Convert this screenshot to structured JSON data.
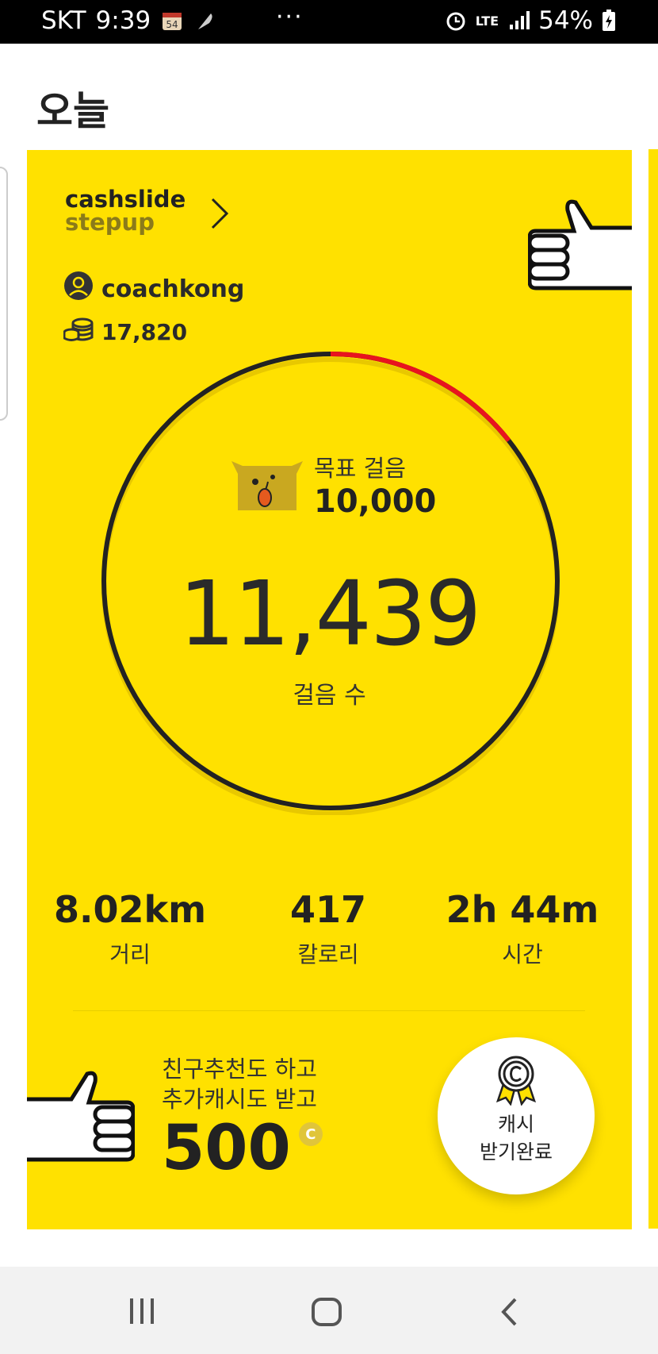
{
  "status_bar": {
    "carrier": "SKT",
    "time": "9:39",
    "calendar_badge": "54",
    "more": "···",
    "network": "LTE",
    "battery": "54%"
  },
  "page": {
    "title": "오늘"
  },
  "card": {
    "brand_line1": "cashslide",
    "brand_line2": "stepup",
    "username": "coachkong",
    "cash_balance": "17,820",
    "goal_label": "목표 걸음",
    "goal_value": "10,000",
    "steps_value": "11,439",
    "steps_label": "걸음 수",
    "progress_fraction": 0.1439,
    "stats": [
      {
        "value": "8.02km",
        "label": "거리"
      },
      {
        "value": "417",
        "label": "칼로리"
      },
      {
        "value": "2h 44m",
        "label": "시간"
      }
    ],
    "promo_line1": "친구추천도 하고",
    "promo_line2": "추가캐시도 받고",
    "promo_amount": "500",
    "coin_symbol": "C",
    "cash_button_line1": "캐시",
    "cash_button_line2": "받기완료"
  },
  "colors": {
    "card_bg": "#FFE100",
    "ring": "#222222",
    "progress": "#E8141E"
  },
  "icons": [
    "calendar-icon",
    "feather-icon",
    "alarm-icon",
    "signal-icon",
    "battery-icon",
    "chevron-right-icon",
    "user-icon",
    "coin-stack-icon",
    "mascot-dog-icon",
    "thumbs-up-icon",
    "medal-icon",
    "recent-apps-icon",
    "home-icon",
    "back-icon"
  ]
}
